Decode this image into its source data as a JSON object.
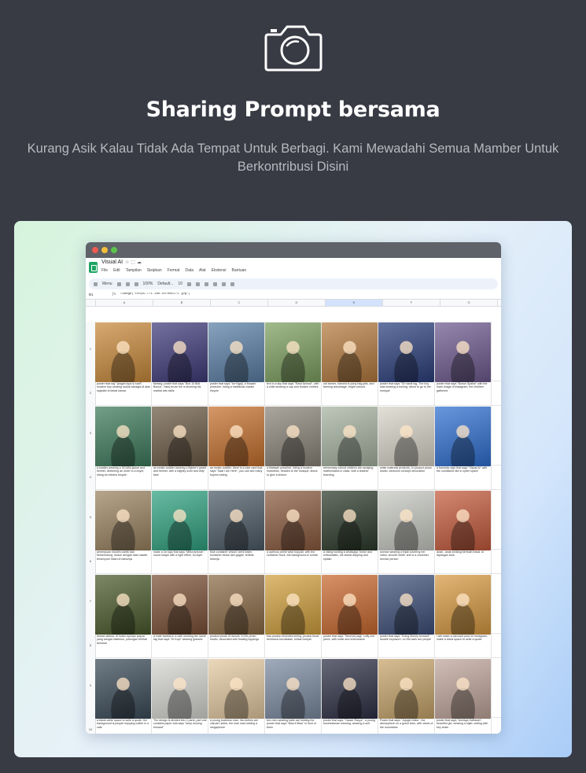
{
  "header": {
    "icon": "camera-icon",
    "title": "Sharing Prompt bersama",
    "subtitle": "Kurang Asik Kalau Tidak Ada Tempat Untuk Berbagi. Kami Mewadahi Semua Mamber Untuk Berkontribusi Disini"
  },
  "window": {
    "doc_title": "Visual AI",
    "menus": [
      "File",
      "Edit",
      "Tampilan",
      "Sisipkan",
      "Format",
      "Data",
      "Alat",
      "Ekstensi",
      "Bantuan"
    ],
    "toolbar": {
      "search": "Menu",
      "zoom": "100%",
      "font": "Default...",
      "size": "10"
    },
    "cell_ref": "B1",
    "formula": "=image(\"https://i.ibb.co/MXEZ/1.jpg\")",
    "columns": [
      "A",
      "B",
      "C",
      "D",
      "E",
      "F",
      "G"
    ],
    "rows": [
      "1",
      "2",
      "3",
      "4",
      "5",
      "6",
      "7",
      "8",
      "9",
      "10"
    ]
  },
  "gallery": {
    "colors": [
      [
        "#c98a3c",
        "#3f3a7a",
        "#5a7fa6",
        "#7da060",
        "#b47a3e",
        "#2b3f7c",
        "#6d5a8e"
      ],
      [
        "#3d7a5a",
        "#6b5a45",
        "#c5702d",
        "#8a8478",
        "#a6b3a0",
        "#d8d4c8",
        "#2f6fd1"
      ],
      [
        "#9a8360",
        "#2fa27f",
        "#4c5a66",
        "#8a5a3e",
        "#2c3a2a",
        "#c7c9c2",
        "#c45a3c"
      ],
      [
        "#4a5a2c",
        "#7a5036",
        "#8a6a45",
        "#d1a03e",
        "#c9682e",
        "#3e4f78",
        "#d89a42"
      ],
      [
        "#3a4a58",
        "#d6d6d2",
        "#e4c9a0",
        "#7b8aa0",
        "#2d2f44",
        "#c7a46a",
        "#bfa59a"
      ]
    ],
    "captions": [
      [
        "poster that say \"jangan lupa si kahf\", modern boy sedang duduk bahagia di atas sajadah di dekat kamar",
        "fantasy, poster that says \"Bos 10 Bidi Bonus\", baby bruce lee is showing his martial arts skills",
        "poster that says \"Ice Ngaji, a Mosam preacher, riding a traditional classic bicycle",
        "text in a sky that says \"Rasir Animal\", with a child wearing a cap and Muslim clothes",
        "old farmer, harvest in pony bag jalls, and farming advantage, bright colours",
        "poster that says \"30 manit lag, The boy was wearing a turning, about to go to the mosque",
        "poster that says \"Bonus Spaise\" with the main image of instagram, the children gathered"
      ],
      [
        "a toddler wearing a SCUBA jacket and helmet, delivering an order to a buyer, riding an electric bicycle",
        "an erratic toddler wearing a fighter's jacket and helmet, with a slightly worn and dirty face",
        "an erratic toddler, there is a cafe card that says \"Saat I am Here\", you can see many buyers eating",
        "a Malawin preacher, riding a modern motorbike, headed to the mosque, about to give a lecture",
        "elementary school children are studying mathematics in class, with a teacher teaching",
        "white mattress products, in product photo studio, bedroom concept decoration",
        "a futuristic sign that says \"Visual AI\" with the conditions like in cyber space"
      ],
      [
        "perempuan muslim cantik dan berkerudung, duduk dengan latar sawah tersenyum hitam di bahunya",
        "make a 3d logo that says \"Mitra Aminah\", round shape with a light effect, 3d style",
        "blue container vessel, semi trailer, kontainer besar dan gagah, terlihat bekerja",
        "a optimus prime wear kopyah, with the container truck, the background is rumah",
        "a viking holding a whatsapp, brave and enthusiastic, his sweat dripping and splash",
        "woman wearing a hijab covering her chest, smooth white, she is a customer service person",
        "anak - anak sedang bermain futsal, di lapangan bola"
      ],
      [
        "hewan alolina, di hutan cyclops papua yang sangat misterius, potongan terlihat bersinar",
        "a male barista in a cafe wearing the name tag that says \"Gi Kopi\" wearing glasses",
        "product photo of donuts, in the photo studio, decorated with floating toppings",
        "foto produk brownies kering, produk lezat, berwarna kecoklatan, tulisan keripik",
        "poster that says \"Sesenal pagi\" Luffy one piece, with smile and enthusiasm",
        "poster that says \"Going Money forward\", double exposure, on the back are people",
        "i will make a carousel post on Instagram, make a blank space to write a quote"
      ],
      [
        "a blank white space to write a quote, the background is people enjoying coffee in a cafe",
        "The design is divided into 2 parts, part one contains paper that says \"keep moving forward\"",
        "a young business man, his clothes are casual t-shirts, the man was holding a megaphone",
        "two men wearing batik are holding the poster that says \"Bisa 8 Bisa\" in front of them",
        "poster that says \"Yasser Rasyo\", a young businessman wearing, wearing a suit",
        "Poster that says \"Jujugel Gabu\", the atmosphere on a guest farm, with views of the mountains",
        "poster that says \"Annisya Hafidzah\", beautiful girl, wearing a hijab, writing with key chain"
      ]
    ]
  }
}
